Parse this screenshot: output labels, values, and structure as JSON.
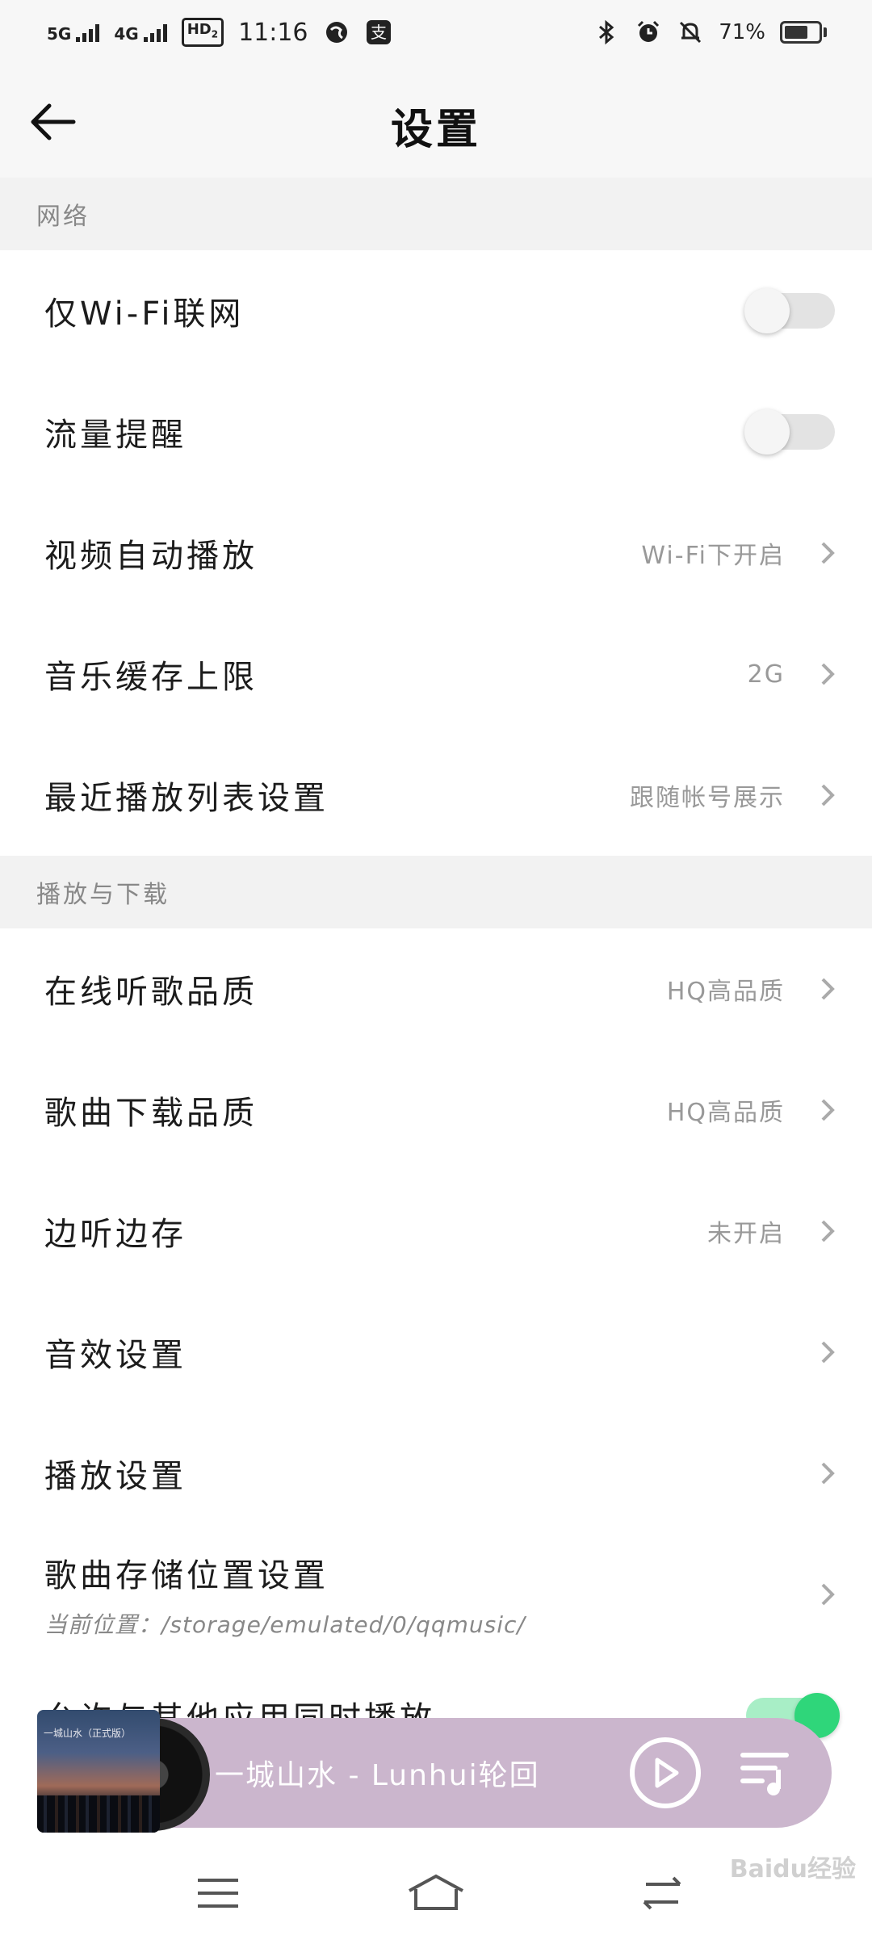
{
  "status_bar": {
    "sim1": "5G",
    "sim2": "4G",
    "hd": "HD",
    "hd_sub": "2",
    "time": "11:16",
    "battery_percent": "71%",
    "battery_level": 0.71,
    "icons": [
      "bluetooth-icon",
      "alarm-icon",
      "mute-bell-icon",
      "battery-icon"
    ]
  },
  "header": {
    "title": "设置",
    "back_icon": "arrow-left-icon"
  },
  "sections": {
    "network": {
      "title": "网络",
      "items": [
        {
          "label": "仅Wi-Fi联网",
          "type": "toggle",
          "on": false
        },
        {
          "label": "流量提醒",
          "type": "toggle",
          "on": false
        },
        {
          "label": "视频自动播放",
          "value": "Wi-Fi下开启"
        },
        {
          "label": "音乐缓存上限",
          "value": "2G"
        },
        {
          "label": "最近播放列表设置",
          "value": "跟随帐号展示"
        }
      ]
    },
    "playback": {
      "title": "播放与下载",
      "items": [
        {
          "label": "在线听歌品质",
          "value": "HQ高品质"
        },
        {
          "label": "歌曲下载品质",
          "value": "HQ高品质"
        },
        {
          "label": "边听边存",
          "value": "未开启"
        },
        {
          "label": "音效设置",
          "value": ""
        },
        {
          "label": "播放设置",
          "value": ""
        },
        {
          "label": "歌曲存储位置设置",
          "sub": "当前位置：/storage/emulated/0/qqmusic/"
        },
        {
          "label": "允许与其他应用同时播放",
          "type": "toggle",
          "on": true
        }
      ]
    }
  },
  "player": {
    "track": "一城山水 - Lunhui轮回",
    "cover_text": "一城山水（正式版）",
    "play_icon": "play-icon",
    "playlist_icon": "playlist-icon"
  },
  "nav": {
    "icons": [
      "menu-icon",
      "home-icon",
      "back-switch-icon"
    ]
  },
  "watermark": "Baidu经验",
  "colors": {
    "toggle_on": "#2fd67a",
    "player_bg": "#cbb6cd",
    "section_bg": "#f2f2f2"
  }
}
